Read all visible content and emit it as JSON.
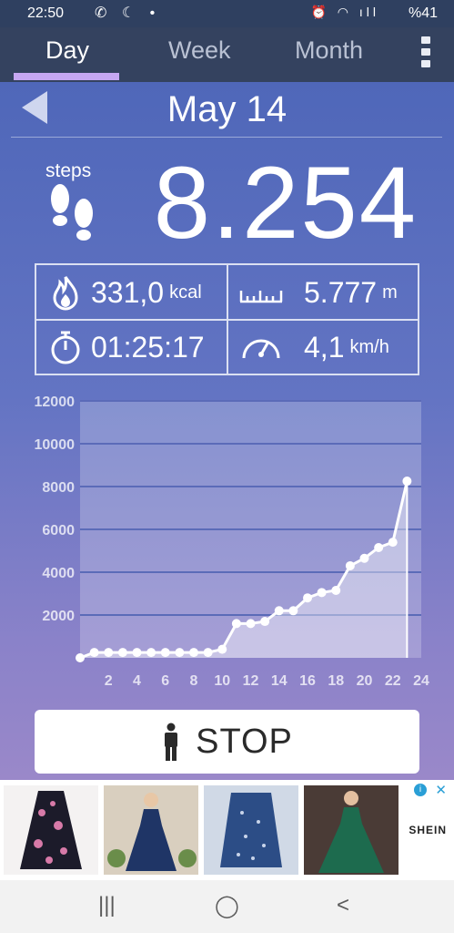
{
  "status": {
    "time": "22:50",
    "left_icons": "✆ ☾ •",
    "right_icons": "⏰ ◠ ıll",
    "battery": "%41"
  },
  "tabs": [
    {
      "label": "Day",
      "active": true
    },
    {
      "label": "Week",
      "active": false
    },
    {
      "label": "Month",
      "active": false
    }
  ],
  "header": {
    "date": "May 14"
  },
  "steps": {
    "label": "steps",
    "value": "8.254"
  },
  "stats": {
    "calories": {
      "value": "331,0",
      "unit": "kcal",
      "icon": "flame-icon"
    },
    "distance": {
      "value": "5.777",
      "unit": "m",
      "icon": "ruler-icon"
    },
    "duration": {
      "value": "01:25:17",
      "unit": "",
      "icon": "stopwatch-icon"
    },
    "speed": {
      "value": "4,1",
      "unit": "km/h",
      "icon": "speedometer-icon"
    }
  },
  "chart_data": {
    "type": "area",
    "x": [
      0,
      1,
      2,
      3,
      4,
      5,
      6,
      7,
      8,
      9,
      10,
      11,
      12,
      13,
      14,
      15,
      16,
      17,
      18,
      19,
      20,
      21,
      22,
      23
    ],
    "values": [
      0,
      250,
      250,
      250,
      250,
      250,
      250,
      250,
      250,
      250,
      400,
      1600,
      1600,
      1700,
      2200,
      2200,
      2800,
      3050,
      3150,
      4300,
      4650,
      5150,
      5400,
      8254
    ],
    "xticks": [
      "2",
      "4",
      "6",
      "8",
      "10",
      "12",
      "14",
      "16",
      "18",
      "20",
      "22",
      "24"
    ],
    "yticks": [
      "2000",
      "4000",
      "6000",
      "8000",
      "10000",
      "12000"
    ],
    "xlim": [
      0,
      24
    ],
    "ylim": [
      0,
      12000
    ],
    "grid": true
  },
  "stop_button": {
    "label": "STOP"
  },
  "ad": {
    "brand": "SHEIN",
    "info": "i",
    "close": "✕"
  },
  "navbar": {
    "recent": "|||",
    "home": "◯",
    "back": "<"
  }
}
